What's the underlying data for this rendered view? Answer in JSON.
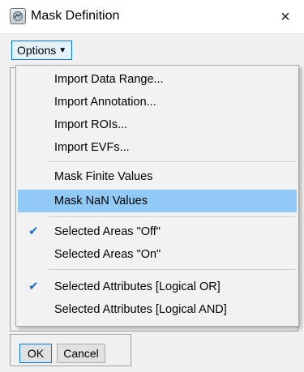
{
  "window": {
    "title": "Mask Definition",
    "close_glyph": "×",
    "app_icon": "app-window-icon"
  },
  "toolbar": {
    "options_label": "Options",
    "options_caret": "▼"
  },
  "menu": {
    "items": [
      {
        "label": "Import Data Range...",
        "checked": false,
        "highlighted": false
      },
      {
        "label": "Import Annotation...",
        "checked": false,
        "highlighted": false
      },
      {
        "label": "Import ROIs...",
        "checked": false,
        "highlighted": false
      },
      {
        "label": "Import EVFs...",
        "checked": false,
        "highlighted": false
      },
      {
        "label": "Mask Finite Values",
        "checked": false,
        "highlighted": false
      },
      {
        "label": "Mask NaN Values",
        "checked": false,
        "highlighted": true
      },
      {
        "label": "Selected Areas \"Off\"",
        "checked": true,
        "highlighted": false
      },
      {
        "label": "Selected Areas \"On\"",
        "checked": false,
        "highlighted": false
      },
      {
        "label": "Selected Attributes [Logical OR]",
        "checked": true,
        "highlighted": false
      },
      {
        "label": "Selected Attributes [Logical AND]",
        "checked": false,
        "highlighted": false
      }
    ],
    "check_glyph": "✔"
  },
  "footer": {
    "ok_label": "OK",
    "cancel_label": "Cancel"
  },
  "colors": {
    "highlight": "#91c9f7",
    "check": "#1b6fc7",
    "focus_border": "#0078d7"
  }
}
